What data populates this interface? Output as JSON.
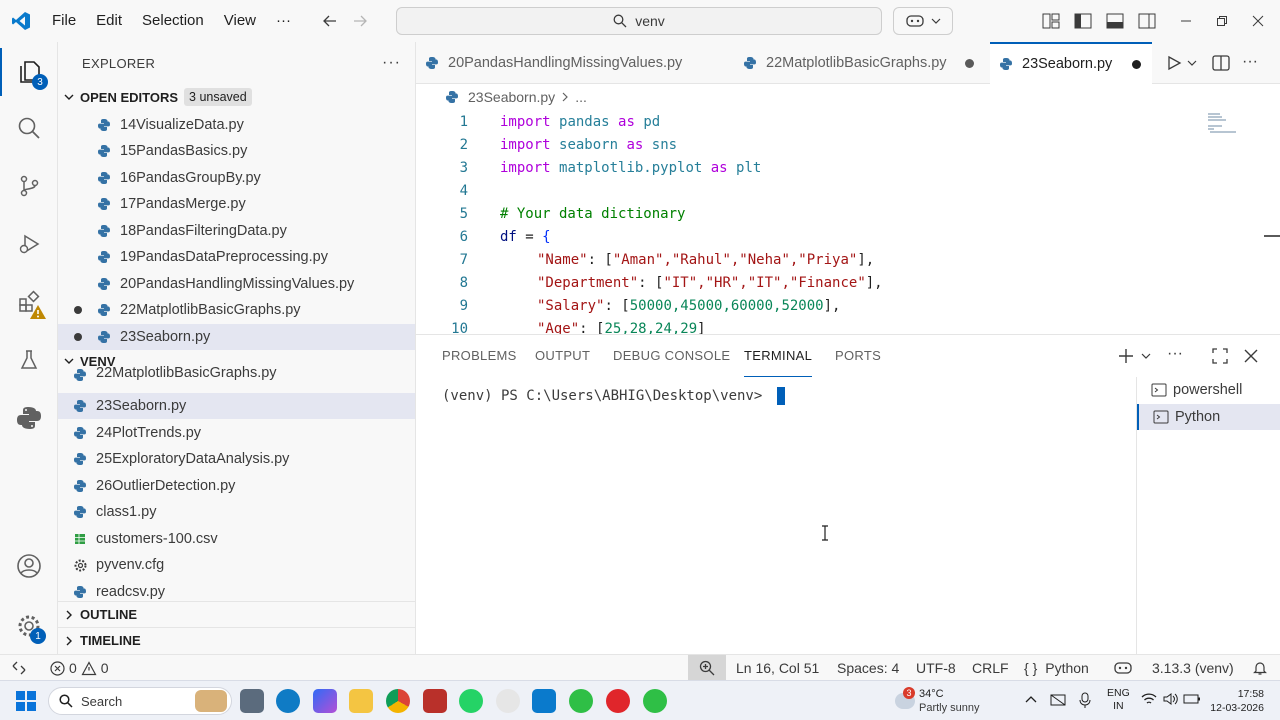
{
  "menu": [
    "File",
    "Edit",
    "Selection",
    "View",
    "···"
  ],
  "command_center": {
    "text": "venv"
  },
  "explorer": {
    "title": "EXPLORER",
    "open_editors": {
      "label": "OPEN EDITORS",
      "badge": "3 unsaved",
      "items": [
        "14VisualizeData.py",
        "15PandasBasics.py",
        "16PandasGroupBy.py",
        "17PandasMerge.py",
        "18PandasFilteringData.py",
        "19PandasDataPreprocessing.py",
        "20PandasHandlingMissingValues.py",
        "22MatplotlibBasicGraphs.py",
        "23Seaborn.py"
      ]
    },
    "venv": {
      "label": "VENV",
      "items": [
        "22MatplotlibBasicGraphs.py",
        "23Seaborn.py",
        "24PlotTrends.py",
        "25ExploratoryDataAnalysis.py",
        "26OutlierDetection.py",
        "class1.py",
        "customers-100.csv",
        "pyvenv.cfg",
        "readcsv.py"
      ]
    },
    "outline": "OUTLINE",
    "timeline": "TIMELINE"
  },
  "activity_badges": {
    "explorer": "3",
    "settings": "1"
  },
  "tabs": [
    "20PandasHandlingMissingValues.py",
    "22MatplotlibBasicGraphs.py",
    "23Seaborn.py"
  ],
  "breadcrumb": {
    "file": "23Seaborn.py",
    "more": "..."
  },
  "code": {
    "line_numbers": [
      "1",
      "2",
      "3",
      "4",
      "5",
      "6",
      "7",
      "8",
      "9",
      "10"
    ],
    "l1": {
      "a": "import",
      "b": "pandas",
      "c": "as",
      "d": "pd"
    },
    "l2": {
      "a": "import",
      "b": "seaborn",
      "c": "as",
      "d": "sns"
    },
    "l3": {
      "a": "import",
      "b": "matplotlib.pyplot",
      "c": "as",
      "d": "plt"
    },
    "l5": "# Your data dictionary",
    "l6": {
      "a": "df",
      "b": " = ",
      "c": "{"
    },
    "l7": {
      "k": "\"Name\"",
      "p": ": [",
      "v": "\"Aman\",\"Rahul\",\"Neha\",\"Priya\"",
      "e": "],"
    },
    "l8": {
      "k": "\"Department\"",
      "p": ": [",
      "v": "\"IT\",\"HR\",\"IT\",\"Finance\"",
      "e": "],"
    },
    "l9": {
      "k": "\"Salary\"",
      "p": ": [",
      "v": "50000,45000,60000,52000",
      "e": "],"
    },
    "l10": {
      "k": "\"Age\"",
      "p": ": [",
      "v": "25,28,24,29",
      "e": "]"
    }
  },
  "panel": {
    "tabs": [
      "PROBLEMS",
      "OUTPUT",
      "DEBUG CONSOLE",
      "TERMINAL",
      "PORTS"
    ],
    "prompt": "(venv) PS C:\\Users\\ABHIG\\Desktop\\venv> ",
    "terminals": [
      "powershell",
      "Python"
    ]
  },
  "status": {
    "errors": "0",
    "warnings": "0",
    "position": "Ln 16, Col 51",
    "spaces": "Spaces: 4",
    "encoding": "UTF-8",
    "eol": "CRLF",
    "language": "Python",
    "interpreter": "3.13.3 (venv)"
  },
  "taskbar": {
    "search": "Search",
    "weather_temp": "34°C",
    "weather_desc": "Partly sunny",
    "weather_badge": "3",
    "lang_top": "ENG",
    "lang_bottom": "IN",
    "time": "17:58",
    "date": "12-03-2026"
  },
  "colors": {
    "accent": "#005fb8",
    "keyword": "#af00db",
    "module": "#267f99",
    "string": "#a31515",
    "number": "#098658",
    "comment": "#008000"
  }
}
